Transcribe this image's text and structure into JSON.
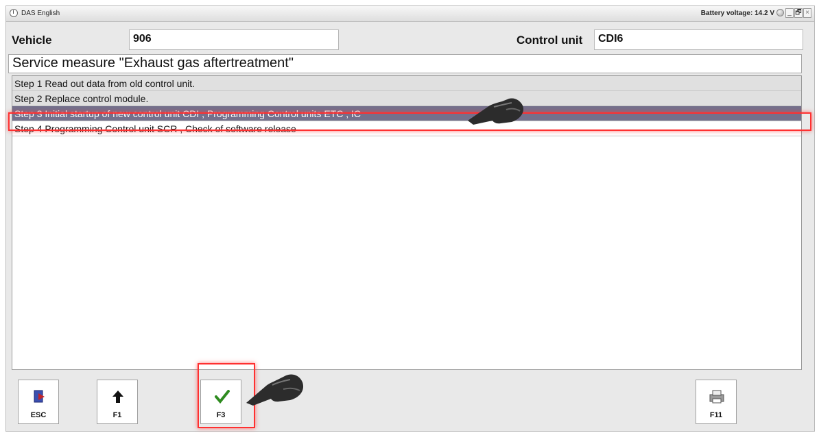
{
  "window": {
    "title": "DAS English",
    "battery_text": "Battery voltage: 14.2 V",
    "controls": [
      "_",
      "🗗",
      "×"
    ]
  },
  "header": {
    "vehicle_label": "Vehicle",
    "vehicle_value": "906",
    "control_unit_label": "Control unit",
    "control_unit_value": "CDI6"
  },
  "service_title": "Service measure \"Exhaust gas aftertreatment\"",
  "steps": [
    {
      "label": "Step 1 Read out data from old control unit."
    },
    {
      "label": "Step 2 Replace control module."
    },
    {
      "label": "Step 3 Initial startup of new control unit CDI , Programming Control units ETC , IC"
    },
    {
      "label": "Step 4 Programming Control unit SCR , Check of software release"
    }
  ],
  "selected_step_index": 2,
  "buttons": {
    "esc": {
      "key": "ESC",
      "icon": "exit-door-icon"
    },
    "f1": {
      "key": "F1",
      "icon": "arrow-up-icon"
    },
    "f3": {
      "key": "F3",
      "icon": "checkmark-icon"
    },
    "f11": {
      "key": "F11",
      "icon": "printer-icon"
    }
  },
  "colors": {
    "selected_row": "#74708c",
    "highlight": "#ff3030",
    "check_green": "#2e8b1f"
  }
}
